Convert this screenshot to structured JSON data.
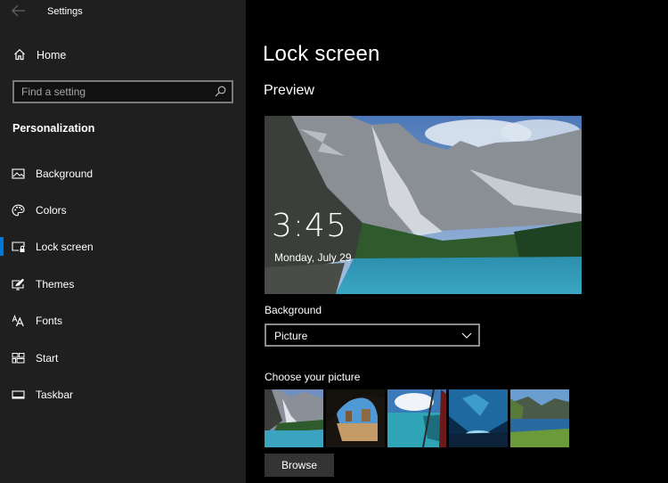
{
  "window": {
    "title": "Settings",
    "back_icon": "back-arrow-icon"
  },
  "sidebar": {
    "home_label": "Home",
    "home_icon": "home-icon",
    "search": {
      "placeholder": "Find a setting",
      "value": "",
      "icon": "search-icon"
    },
    "section_title": "Personalization",
    "items": [
      {
        "label": "Background",
        "icon": "picture-icon",
        "selected": false
      },
      {
        "label": "Colors",
        "icon": "palette-icon",
        "selected": false
      },
      {
        "label": "Lock screen",
        "icon": "lock-screen-icon",
        "selected": true
      },
      {
        "label": "Themes",
        "icon": "themes-icon",
        "selected": false
      },
      {
        "label": "Fonts",
        "icon": "fonts-icon",
        "selected": false
      },
      {
        "label": "Start",
        "icon": "start-icon",
        "selected": false
      },
      {
        "label": "Taskbar",
        "icon": "taskbar-icon",
        "selected": false
      }
    ],
    "accent_color": "#0078d7"
  },
  "main": {
    "page_title": "Lock screen",
    "preview_heading": "Preview",
    "preview": {
      "time": "3:45",
      "date": "Monday, July 29",
      "image": "mountain-lake-landscape"
    },
    "background_label": "Background",
    "background_dropdown": {
      "selected": "Picture",
      "icon": "chevron-down-icon"
    },
    "choose_picture_label": "Choose your picture",
    "thumbnails": [
      {
        "name": "mountain-lake"
      },
      {
        "name": "sea-cave-beach"
      },
      {
        "name": "airplane-window-sea"
      },
      {
        "name": "ice-cave"
      },
      {
        "name": "fjord-lake"
      }
    ],
    "browse_label": "Browse"
  }
}
